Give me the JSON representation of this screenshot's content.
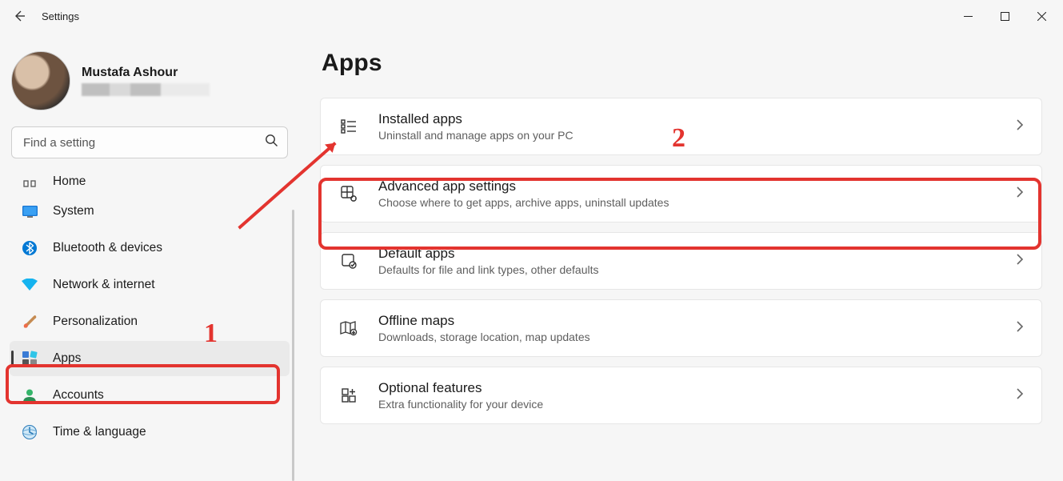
{
  "window": {
    "title": "Settings"
  },
  "profile": {
    "name": "Mustafa Ashour"
  },
  "search": {
    "placeholder": "Find a setting"
  },
  "sidebar": {
    "items": [
      {
        "label": "Home"
      },
      {
        "label": "System"
      },
      {
        "label": "Bluetooth & devices"
      },
      {
        "label": "Network & internet"
      },
      {
        "label": "Personalization"
      },
      {
        "label": "Apps"
      },
      {
        "label": "Accounts"
      },
      {
        "label": "Time & language"
      }
    ],
    "selected_index": 5
  },
  "page": {
    "title": "Apps",
    "cards": [
      {
        "title": "Installed apps",
        "subtitle": "Uninstall and manage apps on your PC"
      },
      {
        "title": "Advanced app settings",
        "subtitle": "Choose where to get apps, archive apps, uninstall updates"
      },
      {
        "title": "Default apps",
        "subtitle": "Defaults for file and link types, other defaults"
      },
      {
        "title": "Offline maps",
        "subtitle": "Downloads, storage location, map updates"
      },
      {
        "title": "Optional features",
        "subtitle": "Extra functionality for your device"
      }
    ]
  },
  "annotations": {
    "num1": "1",
    "num2": "2"
  }
}
